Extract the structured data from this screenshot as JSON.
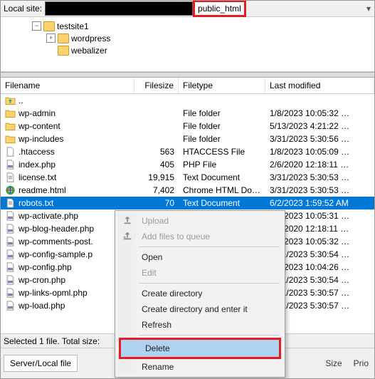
{
  "domain": "Computer-Use",
  "location": {
    "label": "Local site:",
    "path_highlight": "public_html"
  },
  "tree": [
    {
      "level": 0,
      "toggle": "−",
      "icon": "folder",
      "label": "testsite1"
    },
    {
      "level": 1,
      "toggle": "+",
      "icon": "folder",
      "label": "wordpress"
    },
    {
      "level": 1,
      "toggle": "",
      "icon": "folder",
      "label": "webalizer"
    }
  ],
  "columns": {
    "name": "Filename",
    "size": "Filesize",
    "type": "Filetype",
    "mod": "Last modified"
  },
  "files": [
    {
      "icon": "up",
      "name": "..",
      "size": "",
      "type": "",
      "mod": ""
    },
    {
      "icon": "folder",
      "name": "wp-admin",
      "size": "",
      "type": "File folder",
      "mod": "1/8/2023 10:05:32 …"
    },
    {
      "icon": "folder",
      "name": "wp-content",
      "size": "",
      "type": "File folder",
      "mod": "5/13/2023 4:21:22 …"
    },
    {
      "icon": "folder",
      "name": "wp-includes",
      "size": "",
      "type": "File folder",
      "mod": "3/31/2023 5:30:56 …"
    },
    {
      "icon": "file",
      "name": ".htaccess",
      "size": "563",
      "type": "HTACCESS File",
      "mod": "1/8/2023 10:05:09 …"
    },
    {
      "icon": "php",
      "name": "index.php",
      "size": "405",
      "type": "PHP File",
      "mod": "2/6/2020 12:18:11 …"
    },
    {
      "icon": "txt",
      "name": "license.txt",
      "size": "19,915",
      "type": "Text Document",
      "mod": "3/31/2023 5:30:53 …"
    },
    {
      "icon": "html",
      "name": "readme.html",
      "size": "7,402",
      "type": "Chrome HTML Do…",
      "mod": "3/31/2023 5:30:53 …"
    },
    {
      "icon": "txt",
      "name": "robots.txt",
      "size": "70",
      "type": "Text Document",
      "mod": "6/2/2023 1:59:52 AM",
      "selected": true
    },
    {
      "icon": "php",
      "name": "wp-activate.php",
      "size": "",
      "type": "",
      "mod": "1/8/2023 10:05:31 …"
    },
    {
      "icon": "php",
      "name": "wp-blog-header.php",
      "size": "",
      "type": "",
      "mod": "2/6/2020 12:18:11 …"
    },
    {
      "icon": "php",
      "name": "wp-comments-post.",
      "size": "",
      "type": "",
      "mod": "1/8/2023 10:05:32 …"
    },
    {
      "icon": "php",
      "name": "wp-config-sample.p",
      "size": "",
      "type": "",
      "mod": "3/31/2023 5:30:54 …"
    },
    {
      "icon": "php",
      "name": "wp-config.php",
      "size": "",
      "type": "",
      "mod": "1/8/2023 10:04:26 …"
    },
    {
      "icon": "php",
      "name": "wp-cron.php",
      "size": "",
      "type": "",
      "mod": "3/31/2023 5:30:54 …"
    },
    {
      "icon": "php",
      "name": "wp-links-opml.php",
      "size": "",
      "type": "",
      "mod": "3/31/2023 5:30:57 …"
    },
    {
      "icon": "php",
      "name": "wp-load.php",
      "size": "",
      "type": "",
      "mod": "3/31/2023 5:30:57 …"
    }
  ],
  "status_text": "Selected 1 file. Total size:",
  "transfer": {
    "tab": "Server/Local file",
    "size_label": "Size",
    "prio_label": "Prio"
  },
  "context_menu": [
    {
      "label": "Upload",
      "icon": "upload",
      "disabled": true
    },
    {
      "label": "Add files to queue",
      "icon": "queue",
      "disabled": true
    },
    {
      "sep": true
    },
    {
      "label": "Open"
    },
    {
      "label": "Edit",
      "disabled": true
    },
    {
      "sep": true
    },
    {
      "label": "Create directory"
    },
    {
      "label": "Create directory and enter it"
    },
    {
      "label": "Refresh"
    },
    {
      "sep": true
    },
    {
      "label": "Delete",
      "boxed": true
    },
    {
      "label": "Rename"
    }
  ],
  "colors": {
    "selection": "#0078d7",
    "highlight_border": "#e41b23",
    "menu_hover": "#aed2ef"
  }
}
